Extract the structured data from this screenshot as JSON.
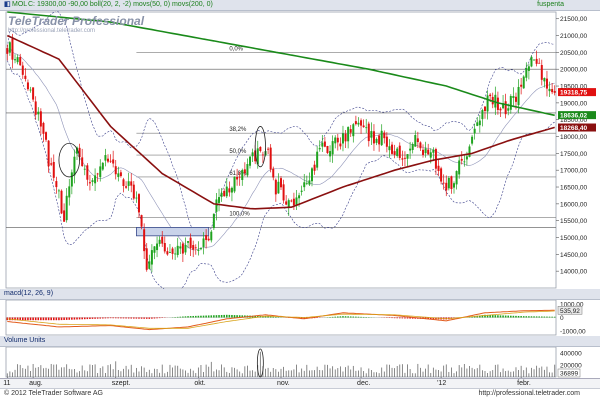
{
  "panel_header": {
    "symbol": "MOL",
    "legend": "C: 19300,00 -90,00 boll(20, 2, -2) movs(50, 0) movs(200, 0)",
    "right_label": "fuspenta"
  },
  "watermark": {
    "title": "TeleTrader Professional",
    "url": "http://professional.teletrader.com"
  },
  "macd_header": {
    "label": "macd(12, 26, 9)"
  },
  "volume_header": {
    "label": "Volume Units"
  },
  "footer": {
    "copyright": "© 2012 TeleTrader Software AG",
    "url": "http://professional.teletrader.com"
  },
  "colors": {
    "up_candle": "#1fa31f",
    "down_candle": "#e01010",
    "ma200": "#1a8a1a",
    "ma50": "#8a1010",
    "bollinger": "#3a3f8a",
    "fib_line": "#7a7a7a",
    "macd_line": "#e25b1c",
    "signal_line": "#d9a31a",
    "volume_bar": "#6a6a6a",
    "price_tag_last": "#e01010",
    "price_tag_ma200": "#1a8a1a",
    "price_tag_ma50": "#8a1010"
  },
  "chart_data": [
    {
      "type": "candlestick",
      "title": "",
      "xlabel": "",
      "ylabel": "",
      "ylim": [
        13500,
        21700
      ],
      "y_ticks": [
        "14000,00",
        "14500,00",
        "15000,00",
        "15500,00",
        "16000,00",
        "16500,00",
        "17000,00",
        "17500,00",
        "18000,00",
        "18500,00",
        "19000,00",
        "19500,00",
        "20000,00",
        "20500,00",
        "21000,00",
        "21500,00"
      ],
      "x_ticks": [
        {
          "label": "11",
          "index": 0
        },
        {
          "label": "aug.",
          "index": 10
        },
        {
          "label": "szept.",
          "index": 42
        },
        {
          "label": "okt.",
          "index": 74
        },
        {
          "label": "nov.",
          "index": 106
        },
        {
          "label": "dec.",
          "index": 137
        },
        {
          "label": "'12",
          "index": 168
        },
        {
          "label": "febr.",
          "index": 199
        }
      ],
      "count": 213,
      "last_close": 19300,
      "key_points": [
        {
          "i": 0,
          "c": 20700
        },
        {
          "i": 6,
          "c": 19800
        },
        {
          "i": 12,
          "c": 18500
        },
        {
          "i": 18,
          "c": 16800
        },
        {
          "i": 22,
          "c": 15500
        },
        {
          "i": 26,
          "c": 17600
        },
        {
          "i": 32,
          "c": 16700
        },
        {
          "i": 38,
          "c": 17200
        },
        {
          "i": 44,
          "c": 16700
        },
        {
          "i": 50,
          "c": 16200
        },
        {
          "i": 54,
          "c": 14300
        },
        {
          "i": 60,
          "c": 14800
        },
        {
          "i": 66,
          "c": 14500
        },
        {
          "i": 72,
          "c": 14700
        },
        {
          "i": 78,
          "c": 15000
        },
        {
          "i": 82,
          "c": 16300
        },
        {
          "i": 88,
          "c": 16700
        },
        {
          "i": 94,
          "c": 17400
        },
        {
          "i": 100,
          "c": 17700
        },
        {
          "i": 104,
          "c": 16500
        },
        {
          "i": 110,
          "c": 16000
        },
        {
          "i": 116,
          "c": 16500
        },
        {
          "i": 122,
          "c": 17700
        },
        {
          "i": 128,
          "c": 17900
        },
        {
          "i": 134,
          "c": 18300
        },
        {
          "i": 140,
          "c": 18000
        },
        {
          "i": 146,
          "c": 17900
        },
        {
          "i": 152,
          "c": 17300
        },
        {
          "i": 158,
          "c": 17800
        },
        {
          "i": 164,
          "c": 17600
        },
        {
          "i": 170,
          "c": 16400
        },
        {
          "i": 176,
          "c": 17300
        },
        {
          "i": 180,
          "c": 17900
        },
        {
          "i": 184,
          "c": 18900
        },
        {
          "i": 188,
          "c": 19200
        },
        {
          "i": 192,
          "c": 18800
        },
        {
          "i": 196,
          "c": 19100
        },
        {
          "i": 200,
          "c": 19700
        },
        {
          "i": 204,
          "c": 20500
        },
        {
          "i": 208,
          "c": 19600
        },
        {
          "i": 212,
          "c": 19300
        }
      ],
      "ma200_points": [
        {
          "i": 0,
          "v": 21700
        },
        {
          "i": 40,
          "v": 21400
        },
        {
          "i": 90,
          "v": 20700
        },
        {
          "i": 140,
          "v": 20000
        },
        {
          "i": 170,
          "v": 19500
        },
        {
          "i": 190,
          "v": 19000
        },
        {
          "i": 212,
          "v": 18630
        }
      ],
      "ma50_points": [
        {
          "i": 0,
          "v": 21000
        },
        {
          "i": 20,
          "v": 20300
        },
        {
          "i": 40,
          "v": 18300
        },
        {
          "i": 60,
          "v": 16900
        },
        {
          "i": 80,
          "v": 16000
        },
        {
          "i": 95,
          "v": 15850
        },
        {
          "i": 110,
          "v": 15900
        },
        {
          "i": 130,
          "v": 16500
        },
        {
          "i": 150,
          "v": 17000
        },
        {
          "i": 165,
          "v": 17300
        },
        {
          "i": 180,
          "v": 17500
        },
        {
          "i": 195,
          "v": 17900
        },
        {
          "i": 212,
          "v": 18270
        }
      ],
      "fib_levels": [
        {
          "label": "0,0%",
          "value": 20500
        },
        {
          "label": "38,2%",
          "value": 18100
        },
        {
          "label": "50,0%",
          "value": 17450
        },
        {
          "label": "61,8%",
          "value": 16800
        },
        {
          "label": "100,0%",
          "value": 15600
        }
      ],
      "h_lines": [
        20000,
        18700,
        15300
      ],
      "price_tags": [
        {
          "label": "19318,75",
          "value": 19320,
          "color_key": "price_tag_last"
        },
        {
          "label": "18636,02",
          "value": 18636,
          "color_key": "price_tag_ma200"
        },
        {
          "label": "18268,40",
          "value": 18268,
          "color_key": "price_tag_ma50"
        }
      ],
      "support_box": {
        "from": 50,
        "to": 78,
        "low": 15050,
        "high": 15300
      },
      "annotation_ellipses": [
        {
          "i": 24,
          "value": 17300,
          "di": 4,
          "dv": 500
        },
        {
          "i": 98,
          "value": 17700,
          "di": 2,
          "dv": 600
        }
      ]
    },
    {
      "type": "line",
      "title": "",
      "xlabel": "",
      "ylabel": "",
      "ylim": [
        -1300,
        1300
      ],
      "y_ticks": [
        "1000,00",
        "0",
        "-1000,00"
      ],
      "last_label": "535,92",
      "series": [
        {
          "name": "",
          "points": [
            {
              "i": 0,
              "v": -300
            },
            {
              "i": 20,
              "v": -700
            },
            {
              "i": 40,
              "v": -600
            },
            {
              "i": 55,
              "v": -900
            },
            {
              "i": 70,
              "v": -700
            },
            {
              "i": 85,
              "v": -100
            },
            {
              "i": 100,
              "v": 200
            },
            {
              "i": 115,
              "v": -100
            },
            {
              "i": 130,
              "v": 350
            },
            {
              "i": 150,
              "v": 150
            },
            {
              "i": 170,
              "v": -250
            },
            {
              "i": 185,
              "v": 350
            },
            {
              "i": 200,
              "v": 500
            },
            {
              "i": 212,
              "v": 536
            }
          ]
        },
        {
          "name": "",
          "points": [
            {
              "i": 0,
              "v": -100
            },
            {
              "i": 20,
              "v": -500
            },
            {
              "i": 40,
              "v": -550
            },
            {
              "i": 55,
              "v": -800
            },
            {
              "i": 70,
              "v": -800
            },
            {
              "i": 85,
              "v": -300
            },
            {
              "i": 100,
              "v": 100
            },
            {
              "i": 115,
              "v": 0
            },
            {
              "i": 130,
              "v": 250
            },
            {
              "i": 150,
              "v": 200
            },
            {
              "i": 170,
              "v": -100
            },
            {
              "i": 185,
              "v": 150
            },
            {
              "i": 200,
              "v": 400
            },
            {
              "i": 212,
              "v": 480
            }
          ]
        }
      ]
    },
    {
      "type": "bar",
      "title": "",
      "xlabel": "",
      "ylabel": "",
      "ylim": [
        0,
        500000
      ],
      "y_ticks": [
        "400000",
        "200000"
      ],
      "last_label": "36899",
      "highlight_index": 98
    }
  ]
}
